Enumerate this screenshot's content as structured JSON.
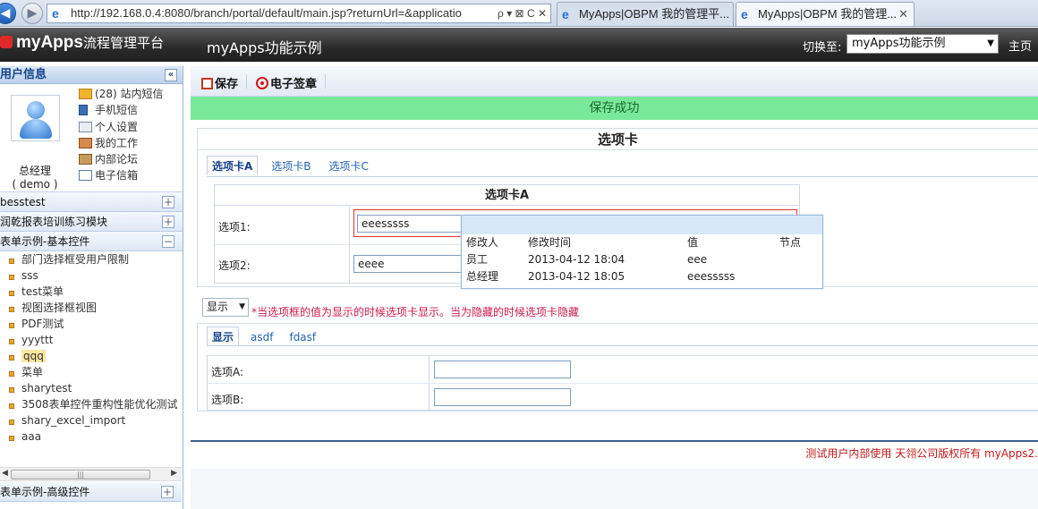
{
  "browser": {
    "address": "http://192.168.0.4:8080/branch/portal/default/main.jsp?returnUrl=&applicatio",
    "address_tools": "ρ ▾ ⊠ C ✕",
    "tabs": [
      {
        "label": "MyApps|OBPM 我的管理平..."
      },
      {
        "label": "MyApps|OBPM 我的管理...",
        "close": "✕"
      }
    ]
  },
  "header": {
    "brand": "myApps",
    "platform": "流程管理平台",
    "app_title": "myApps功能示例",
    "switch_label": "切换至:",
    "switch_value": "myApps功能示例",
    "home": "主页"
  },
  "sidebar": {
    "user_info_title": "用户信息",
    "collapse": "«",
    "user_name": "总经理",
    "user_id": "( demo )",
    "menu": [
      {
        "label": "(28) 站内短信",
        "icon": "mail-icon"
      },
      {
        "label": "手机短信",
        "icon": "phone-icon"
      },
      {
        "label": "个人设置",
        "icon": "settings-icon"
      },
      {
        "label": "我的工作",
        "icon": "work-icon"
      },
      {
        "label": "内部论坛",
        "icon": "forum-icon"
      },
      {
        "label": "电子信箱",
        "icon": "email-icon"
      }
    ],
    "modules": [
      {
        "label": "besstest",
        "toggle": "+"
      },
      {
        "label": "润乾报表培训练习模块",
        "toggle": "+"
      },
      {
        "label": "表单示例-基本控件",
        "toggle": "−"
      }
    ],
    "tree": [
      "部门选择框受用户限制",
      "sss",
      "test菜单",
      "视图选择框视图",
      "PDF测试",
      "yyyttt",
      "qqq",
      "菜单",
      "sharytest",
      "3508表单控件重构性能优化测试",
      "shary_excel_import",
      "aaa"
    ],
    "selected_tree_item": "qqq",
    "modules_bottom": [
      {
        "label": "表单示例-高级控件",
        "toggle": "+"
      }
    ]
  },
  "toolbar": {
    "save": "保存",
    "seal": "电子签章"
  },
  "message": "保存成功",
  "form": {
    "title": "选项卡",
    "tabs": [
      "选项卡A",
      "选项卡B",
      "选项卡C"
    ],
    "section_title": "选项卡A",
    "field1_label": "选项1:",
    "field1_value": "eeesssss",
    "field2_label": "选项2:",
    "field2_value": "eeee"
  },
  "history": {
    "headers": [
      "修改人",
      "修改时间",
      "值",
      "节点"
    ],
    "rows": [
      {
        "user": "员工",
        "time": "2013-04-12 18:04",
        "value": "eee",
        "node": ""
      },
      {
        "user": "总经理",
        "time": "2013-04-12 18:05",
        "value": "eeesssss",
        "node": ""
      }
    ]
  },
  "display_select": {
    "value": "显示",
    "hint": "*当选项框的值为显示的时候选项卡显示。当为隐藏的时候选项卡隐藏"
  },
  "form_b": {
    "tabs": [
      "显示",
      "asdf",
      "fdasf"
    ],
    "fieldA_label": "选项A:",
    "fieldB_label": "选项B:"
  },
  "footer": "测试用户内部使用  天翎公司版权所有  myApps2.",
  "colors": {
    "success_bg": "#7ae89a",
    "hint_color": "#cc1a4d",
    "footer_color": "#c01818"
  }
}
